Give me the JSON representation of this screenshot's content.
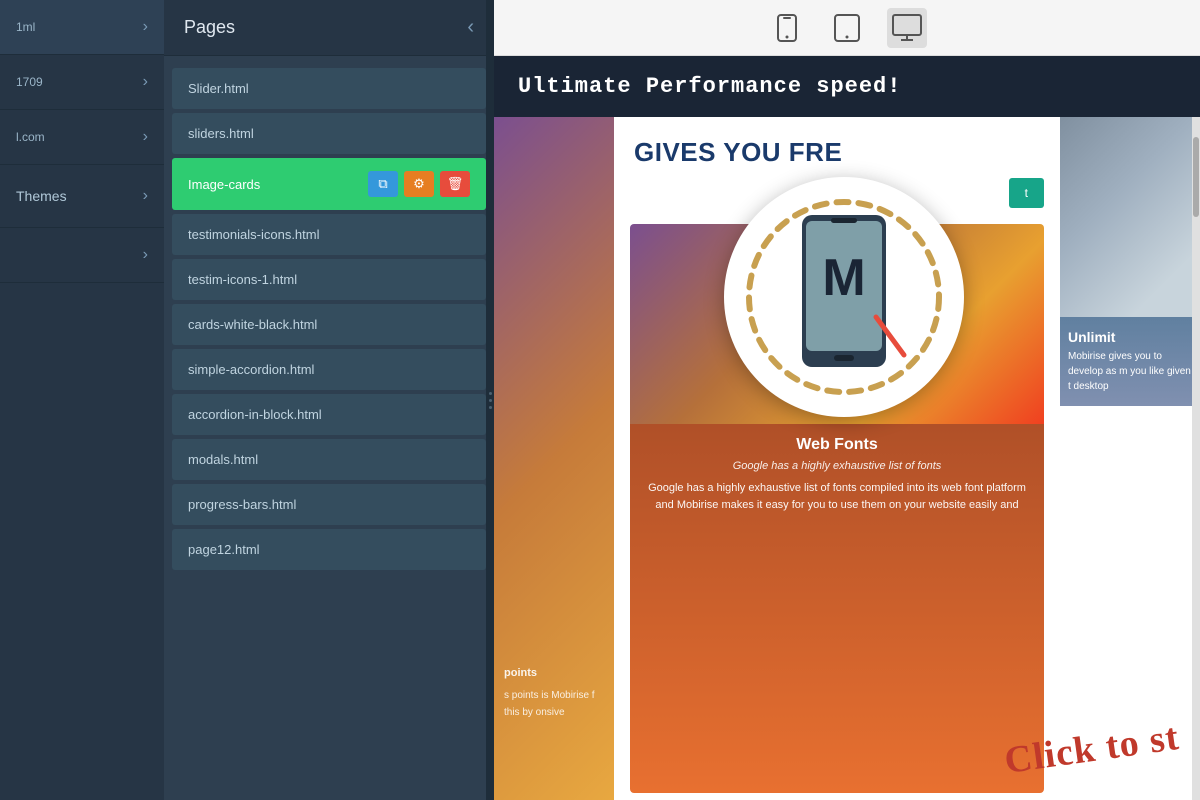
{
  "sidebar": {
    "items": [
      {
        "label": "1ml",
        "hasChevron": true
      },
      {
        "label": "1709",
        "hasChevron": true
      },
      {
        "label": "l.com",
        "hasChevron": true
      },
      {
        "label": "& Themes",
        "hasChevron": true
      },
      {
        "label": "",
        "hasChevron": true
      }
    ],
    "themes_label": "Themes"
  },
  "pages_panel": {
    "title": "Pages",
    "close_icon": "‹",
    "items": [
      {
        "name": "Slider.html",
        "active": false
      },
      {
        "name": "sliders.html",
        "active": false
      },
      {
        "name": "Image-cards",
        "active": true
      },
      {
        "name": "testimonials-icons.html",
        "active": false
      },
      {
        "name": "testim-icons-1.html",
        "active": false
      },
      {
        "name": "cards-white-black.html",
        "active": false
      },
      {
        "name": "simple-accordion.html",
        "active": false
      },
      {
        "name": "accordion-in-block.html",
        "active": false
      },
      {
        "name": "modals.html",
        "active": false
      },
      {
        "name": "progress-bars.html",
        "active": false
      },
      {
        "name": "page12.html",
        "active": false
      }
    ],
    "action_copy": "⧉",
    "action_settings": "⚙",
    "action_delete": "🗑"
  },
  "toolbar": {
    "mobile_icon": "📱",
    "tablet_icon": "⬜",
    "desktop_icon": "🖥"
  },
  "preview": {
    "banner_text": "Ultimate Performance speed!",
    "gives_you_text": "GIVES YOU FRE",
    "card1": {
      "title": "Web Fonts",
      "subtitle": "Google has a highly exhaustive list of fonts",
      "body": "Google has a highly exhaustive list of fonts compiled into its web font platform and Mobirise makes it easy for you to use them on your website easily and"
    },
    "card2": {
      "title": "Unlimit",
      "subtitle": "Mobirise gives y...",
      "body": "Mobirise gives you to develop as m you like given t desktop"
    },
    "left_col_text1": "points",
    "left_col_text2": "s points is Mobirise f this by onsive",
    "magnify": {
      "m_letter": "M"
    },
    "click_text": "Click to st",
    "unlimited_partial": "Unlimit"
  },
  "colors": {
    "sidebar_bg": "#263545",
    "pages_panel_bg": "#2e3f50",
    "active_page_bg": "#2ecc71",
    "banner_bg": "#1a2535",
    "accent_blue": "#1a3a6b",
    "card1_bg": "#c0392b",
    "card2_bg": "#2980b9",
    "delete_btn": "#e74c3c",
    "settings_btn": "#e67e22",
    "copy_btn": "#3498db"
  }
}
